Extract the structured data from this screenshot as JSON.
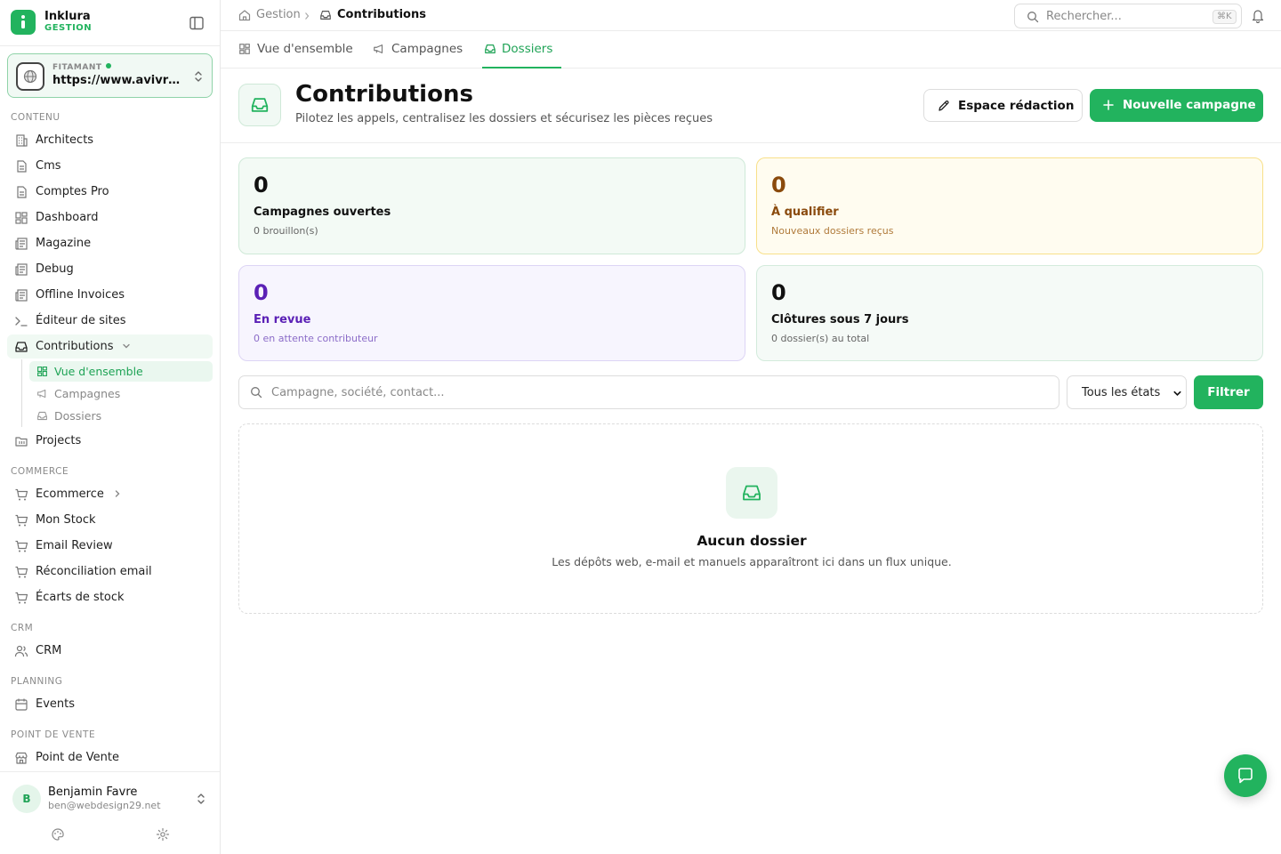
{
  "brand": {
    "name": "Inklura",
    "sub": "GESTION"
  },
  "site": {
    "label": "FITAMANT",
    "url": "https://www.avivre-immobilier.fr"
  },
  "sections": {
    "contenu": "CONTENU",
    "commerce": "COMMERCE",
    "crm": "CRM",
    "planning": "PLANNING",
    "pos": "POINT DE VENTE"
  },
  "nav": {
    "architects": "Architects",
    "cms": "Cms",
    "comptes": "Comptes Pro",
    "dashboard": "Dashboard",
    "magazine": "Magazine",
    "debug": "Debug",
    "offline": "Offline Invoices",
    "editeur": "Éditeur de sites",
    "contributions": "Contributions",
    "sub_overview": "Vue d'ensemble",
    "sub_campagnes": "Campagnes",
    "sub_dossiers": "Dossiers",
    "projects": "Projects",
    "ecommerce": "Ecommerce",
    "stock": "Mon Stock",
    "email_review": "Email Review",
    "reconciliation": "Réconciliation email",
    "ecarts": "Écarts de stock",
    "crm": "CRM",
    "events": "Events",
    "pos": "Point de Vente"
  },
  "user": {
    "initial": "B",
    "name": "Benjamin Favre",
    "email": "ben@webdesign29.net"
  },
  "breadcrumb": {
    "root": "Gestion",
    "current": "Contributions"
  },
  "search": {
    "placeholder": "Rechercher...",
    "shortcut": "⌘K"
  },
  "tabs": {
    "overview": "Vue d'ensemble",
    "campagnes": "Campagnes",
    "dossiers": "Dossiers"
  },
  "header": {
    "title": "Contributions",
    "subtitle": "Pilotez les appels, centralisez les dossiers et sécurisez les pièces reçues",
    "btn_edit": "Espace rédaction",
    "btn_new": "Nouvelle campagne"
  },
  "stats": [
    {
      "value": "0",
      "name": "Campagnes ouvertes",
      "desc": "0 brouillon(s)"
    },
    {
      "value": "0",
      "name": "À qualifier",
      "desc": "Nouveaux dossiers reçus"
    },
    {
      "value": "0",
      "name": "En revue",
      "desc": "0 en attente contributeur"
    },
    {
      "value": "0",
      "name": "Clôtures sous 7 jours",
      "desc": "0 dossier(s) au total"
    }
  ],
  "filter": {
    "placeholder": "Campagne, société, contact...",
    "state": "Tous les états",
    "button": "Filtrer"
  },
  "empty": {
    "title": "Aucun dossier",
    "desc": "Les dépôts web, e-mail et manuels apparaîtront ici dans un flux unique."
  },
  "colors": {
    "accent": "#22b35e",
    "amber": "#8a4a0c",
    "purple": "#5b21b6"
  }
}
